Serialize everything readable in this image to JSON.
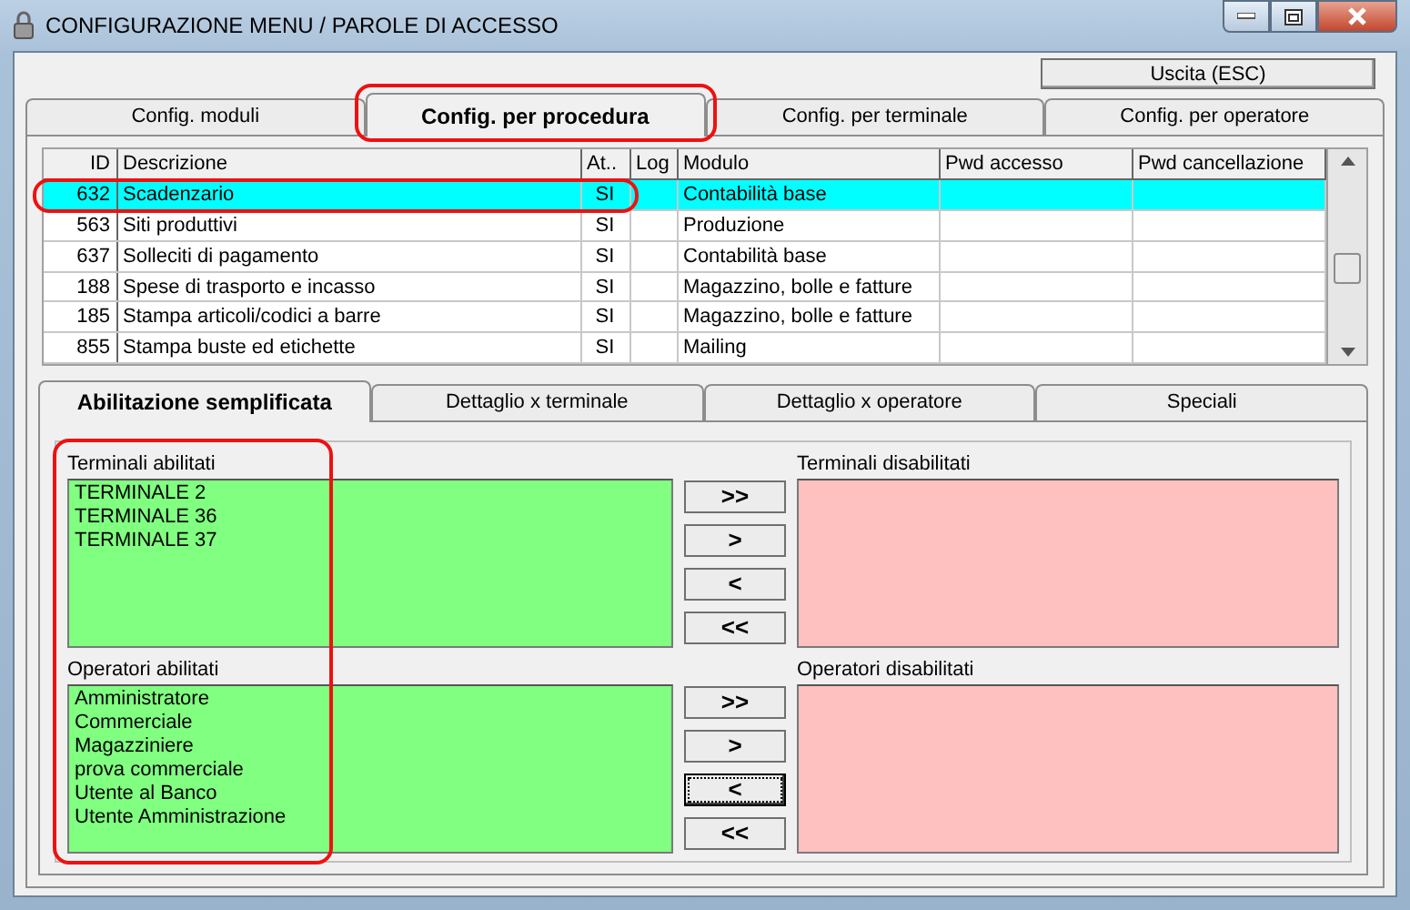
{
  "window": {
    "title": "CONFIGURAZIONE MENU / PAROLE DI ACCESSO"
  },
  "exit_button": "Uscita (ESC)",
  "tabs": [
    {
      "label": "Config. moduli",
      "selected": false,
      "highlighted": false
    },
    {
      "label": "Config. per procedura",
      "selected": true,
      "highlighted": true
    },
    {
      "label": "Config. per terminale",
      "selected": false,
      "highlighted": false
    },
    {
      "label": "Config. per operatore",
      "selected": false,
      "highlighted": false
    }
  ],
  "grid": {
    "columns": [
      "ID",
      "Descrizione",
      "At..",
      "Log",
      "Modulo",
      "Pwd accesso",
      "Pwd cancellazione"
    ],
    "rows": [
      {
        "id": "632",
        "description": "Scadenzario",
        "active": "SI",
        "module": "Contabilità base",
        "selected": true,
        "highlighted": true
      },
      {
        "id": "563",
        "description": "Siti produttivi",
        "active": "SI",
        "module": "Produzione",
        "selected": false,
        "highlighted": false
      },
      {
        "id": "637",
        "description": "Solleciti di pagamento",
        "active": "SI",
        "module": "Contabilità base",
        "selected": false,
        "highlighted": false
      },
      {
        "id": "188",
        "description": "Spese di trasporto e incasso",
        "active": "SI",
        "module": "Magazzino, bolle e fatture",
        "selected": false,
        "highlighted": false
      },
      {
        "id": "185",
        "description": "Stampa articoli/codici a barre",
        "active": "SI",
        "module": "Magazzino, bolle e fatture",
        "selected": false,
        "highlighted": false
      },
      {
        "id": "855",
        "description": "Stampa buste ed etichette",
        "active": "SI",
        "module": "Mailing",
        "selected": false,
        "highlighted": false
      }
    ]
  },
  "sub_tabs": [
    {
      "label": "Abilitazione semplificata",
      "selected": true
    },
    {
      "label": "Dettaglio x terminale",
      "selected": false
    },
    {
      "label": "Dettaglio x operatore",
      "selected": false
    },
    {
      "label": "Speciali",
      "selected": false
    }
  ],
  "enabled_lists_highlighted": true,
  "sections": [
    {
      "enabled_label": "Terminali abilitati",
      "enabled_items": [
        "TERMINALE 2",
        "TERMINALE 36",
        "TERMINALE 37"
      ],
      "disabled_label": "Terminali disabilitati",
      "buttons": [
        {
          "label": ">>",
          "focused": false
        },
        {
          "label": ">",
          "focused": false
        },
        {
          "label": "<",
          "focused": false
        },
        {
          "label": "<<",
          "focused": false
        }
      ]
    },
    {
      "enabled_label": "Operatori abilitati",
      "enabled_items": [
        "Amministratore",
        "Commerciale",
        "Magazziniere",
        "prova commerciale",
        "Utente al Banco",
        "Utente Amministrazione"
      ],
      "disabled_label": "Operatori disabilitati",
      "buttons": [
        {
          "label": ">>",
          "focused": false
        },
        {
          "label": ">",
          "focused": false
        },
        {
          "label": "<",
          "focused": true
        },
        {
          "label": "<<",
          "focused": false
        }
      ]
    }
  ]
}
